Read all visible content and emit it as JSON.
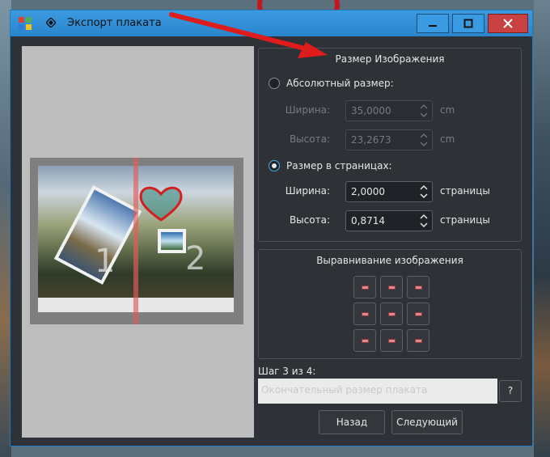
{
  "window": {
    "title": "Экспорт плаката"
  },
  "preview": {
    "page1": "1",
    "page2": "2"
  },
  "size_group": {
    "title": "Размер Изображения",
    "absolute_label": "Абсолютный размер:",
    "abs_width_label": "Ширина:",
    "abs_width_value": "35,0000",
    "abs_width_unit": "cm",
    "abs_height_label": "Высота:",
    "abs_height_value": "23,2673",
    "abs_height_unit": "cm",
    "pages_label": "Размер в страницах:",
    "pages_width_label": "Ширина:",
    "pages_width_value": "2,0000",
    "pages_width_unit": "страницы",
    "pages_height_label": "Высота:",
    "pages_height_value": "0,8714",
    "pages_height_unit": "страницы",
    "selected": "pages"
  },
  "align_group": {
    "title": "Выравнивание изображения"
  },
  "wizard": {
    "step_label": "Шаг 3 из 4:",
    "step_desc": "Окончательный размер плаката",
    "help_label": "?",
    "back_label": "Назад",
    "next_label": "Следующий"
  },
  "colors": {
    "titlebar": "#2a86cc",
    "accent": "#3daee9",
    "arrow": "#e01b1b",
    "close": "#c94141"
  }
}
